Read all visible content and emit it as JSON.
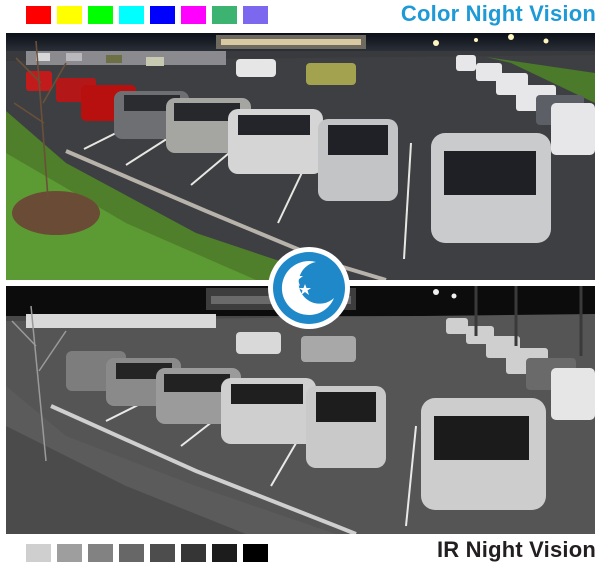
{
  "top_banner": {
    "title": "Color Night Vision",
    "title_color": "#1e9ad6",
    "swatches": [
      "#ff0000",
      "#ffff00",
      "#00ff00",
      "#00ffff",
      "#0000ff",
      "#ff00ff",
      "#3cb371",
      "#7b68ee"
    ]
  },
  "bottom_banner": {
    "title": "IR Night Vision",
    "title_color": "#231f20",
    "swatches": [
      "#cfcfcf",
      "#9e9e9e",
      "#828282",
      "#676767",
      "#4d4d4d",
      "#353535",
      "#1c1c1c",
      "#000000"
    ]
  },
  "center_icon": {
    "name": "moon-stars-icon",
    "fill": "#1e88c9"
  }
}
